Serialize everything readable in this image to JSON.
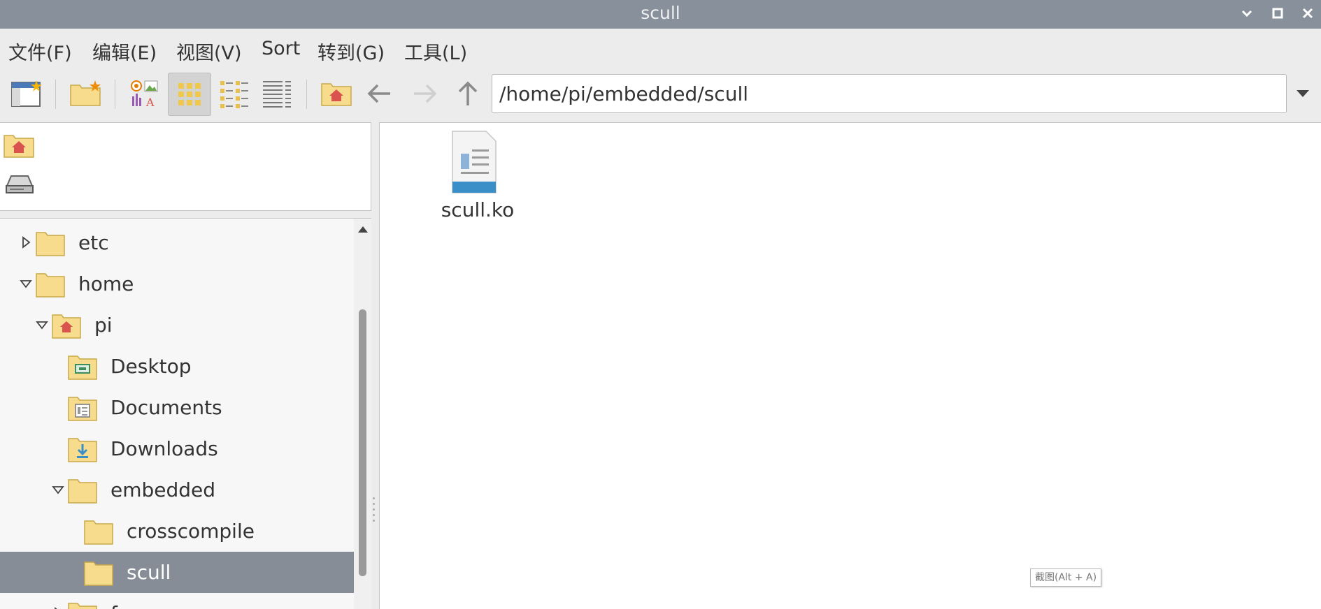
{
  "window": {
    "title": "scull"
  },
  "menu": [
    {
      "label": "文件(F)"
    },
    {
      "label": "编辑(E)"
    },
    {
      "label": "视图(V)"
    },
    {
      "label": "Sort"
    },
    {
      "label": "转到(G)"
    },
    {
      "label": "工具(L)"
    }
  ],
  "toolbar": {
    "path": "/home/pi/embedded/scull",
    "active_view": "icon-view"
  },
  "places": [
    {
      "icon": "home-folder-icon"
    },
    {
      "icon": "drive-icon"
    }
  ],
  "tree": [
    {
      "label": "etc",
      "expander": "collapsed",
      "icon": "folder",
      "depth": 0
    },
    {
      "label": "home",
      "expander": "expanded",
      "icon": "folder",
      "depth": 0
    },
    {
      "label": "pi",
      "expander": "expanded",
      "icon": "home-folder",
      "depth": 1
    },
    {
      "label": "Desktop",
      "expander": "none",
      "icon": "desktop-folder",
      "depth": 2
    },
    {
      "label": "Documents",
      "expander": "none",
      "icon": "documents-folder",
      "depth": 2
    },
    {
      "label": "Downloads",
      "expander": "none",
      "icon": "downloads-folder",
      "depth": 2
    },
    {
      "label": "embedded",
      "expander": "expanded",
      "icon": "folder",
      "depth": 2
    },
    {
      "label": "crosscompile",
      "expander": "none",
      "icon": "folder",
      "depth": 3
    },
    {
      "label": "scull",
      "expander": "none",
      "icon": "folder",
      "depth": 3,
      "selected": true
    },
    {
      "label": "face",
      "expander": "collapsed",
      "icon": "folder",
      "depth": 2
    }
  ],
  "files": [
    {
      "name": "scull.ko",
      "icon": "document-icon"
    }
  ],
  "tooltip": "截图(Alt + A)"
}
